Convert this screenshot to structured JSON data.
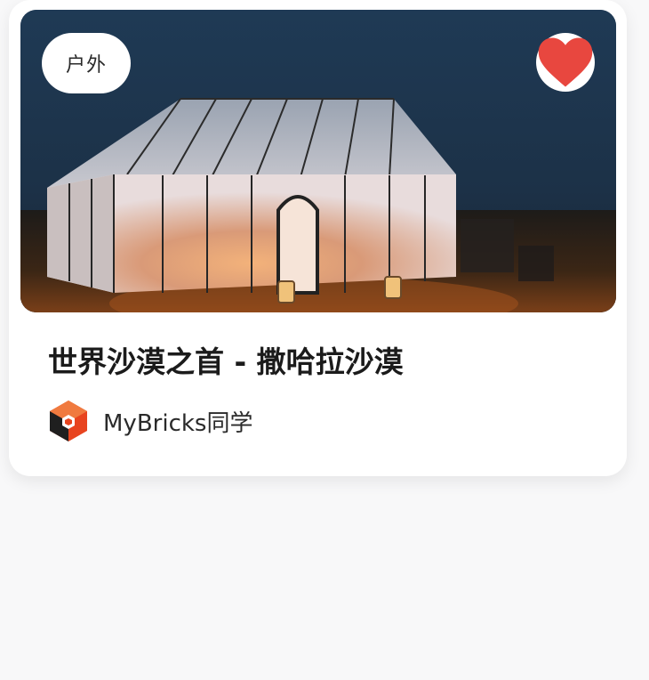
{
  "card": {
    "tag_label": "户外",
    "title": "世界沙漠之首 - 撒哈拉沙漠",
    "author_name": "MyBricks同学",
    "favorite_icon": "heart-icon",
    "favorite_color": "#e8473f",
    "cover_image": "desert-tent-night-photo",
    "avatar_icon": "mybricks-logo-icon",
    "brand_colors": [
      "#e8441f",
      "#1f1f1f"
    ]
  }
}
